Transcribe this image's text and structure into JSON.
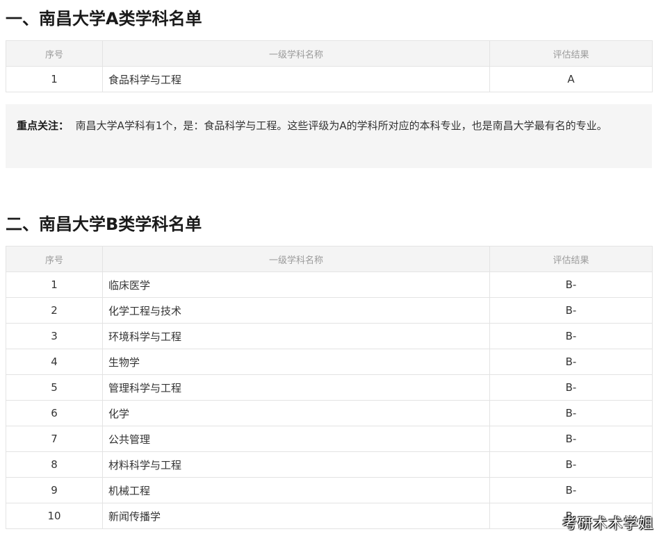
{
  "section_a": {
    "heading": "一、南昌大学A类学科名单",
    "columns": [
      "序号",
      "一级学科名称",
      "评估结果"
    ],
    "rows": [
      {
        "num": "1",
        "name": "食品科学与工程",
        "grade": "A"
      }
    ],
    "note": {
      "label": "重点关注：",
      "text": "南昌大学A学科有1个，是：食品科学与工程。这些评级为A的学科所对应的本科专业，也是南昌大学最有名的专业。"
    }
  },
  "section_b": {
    "heading": "二、南昌大学B类学科名单",
    "columns": [
      "序号",
      "一级学科名称",
      "评估结果"
    ],
    "rows": [
      {
        "num": "1",
        "name": "临床医学",
        "grade": "B-"
      },
      {
        "num": "2",
        "name": "化学工程与技术",
        "grade": "B-"
      },
      {
        "num": "3",
        "name": "环境科学与工程",
        "grade": "B-"
      },
      {
        "num": "4",
        "name": "生物学",
        "grade": "B-"
      },
      {
        "num": "5",
        "name": "管理科学与工程",
        "grade": "B-"
      },
      {
        "num": "6",
        "name": "化学",
        "grade": "B-"
      },
      {
        "num": "7",
        "name": "公共管理",
        "grade": "B-"
      },
      {
        "num": "8",
        "name": "材料科学与工程",
        "grade": "B-"
      },
      {
        "num": "9",
        "name": "机械工程",
        "grade": "B-"
      },
      {
        "num": "10",
        "name": "新闻传播学",
        "grade": "B-"
      }
    ]
  },
  "watermark": "考研术术学姐"
}
